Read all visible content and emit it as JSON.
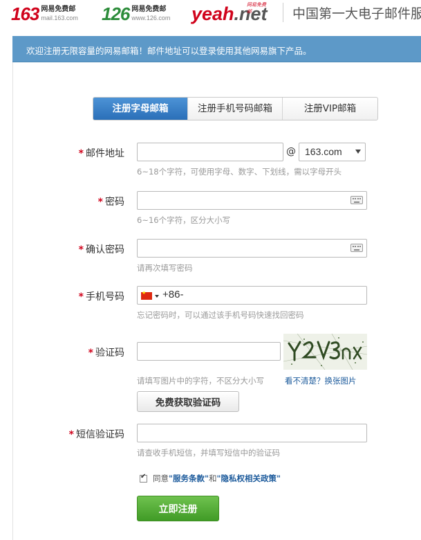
{
  "header": {
    "logo_163": {
      "number": "163",
      "line1": "网易免费邮",
      "line2": "mail.163.com"
    },
    "logo_126": {
      "number": "126",
      "line1": "网易免费邮",
      "line2": "www.126.com"
    },
    "logo_yeah": {
      "main": "yeah",
      "suffix": ".net",
      "tagline": "网易免费邮"
    },
    "slogan": "中国第一大电子邮件服务商"
  },
  "banner": {
    "text": "欢迎注册无限容量的网易邮箱！邮件地址可以登录使用其他网易旗下产品。"
  },
  "tabs": [
    {
      "label": "注册字母邮箱",
      "active": true
    },
    {
      "label": "注册手机号码邮箱",
      "active": false
    },
    {
      "label": "注册VIP邮箱",
      "active": false
    }
  ],
  "form": {
    "required_mark": "*",
    "email": {
      "label": "邮件地址",
      "value": "",
      "at": "@",
      "domain": "163.com",
      "hint": "6~18个字符，可使用字母、数字、下划线，需以字母开头"
    },
    "password": {
      "label": "密码",
      "value": "",
      "hint": "6~16个字符，区分大小写"
    },
    "confirm_password": {
      "label": "确认密码",
      "value": "",
      "hint": "请再次填写密码"
    },
    "phone": {
      "label": "手机号码",
      "prefix": "+86-",
      "value": "",
      "hint": "忘记密码时，可以通过该手机号码快速找回密码"
    },
    "captcha": {
      "label": "验证码",
      "value": "",
      "hint": "请填写图片中的字符，不区分大小写",
      "refresh_link": "看不清楚？换张图片"
    },
    "sms_button": "免费获取验证码",
    "sms_code": {
      "label": "短信验证码",
      "value": "",
      "hint": "请查收手机短信，并填写短信中的验证码"
    },
    "agreement": {
      "checked": true,
      "prefix": "同意",
      "terms": "\"服务条款\"",
      "conjunction": "和",
      "privacy": "\"隐私权相关政策\""
    },
    "submit_button": "立即注册"
  },
  "colors": {
    "banner": "#5d99c8",
    "tab_active": "#3a82c9",
    "required": "#d0021b",
    "submit": "#4da82f",
    "link": "#1d5b9c"
  }
}
